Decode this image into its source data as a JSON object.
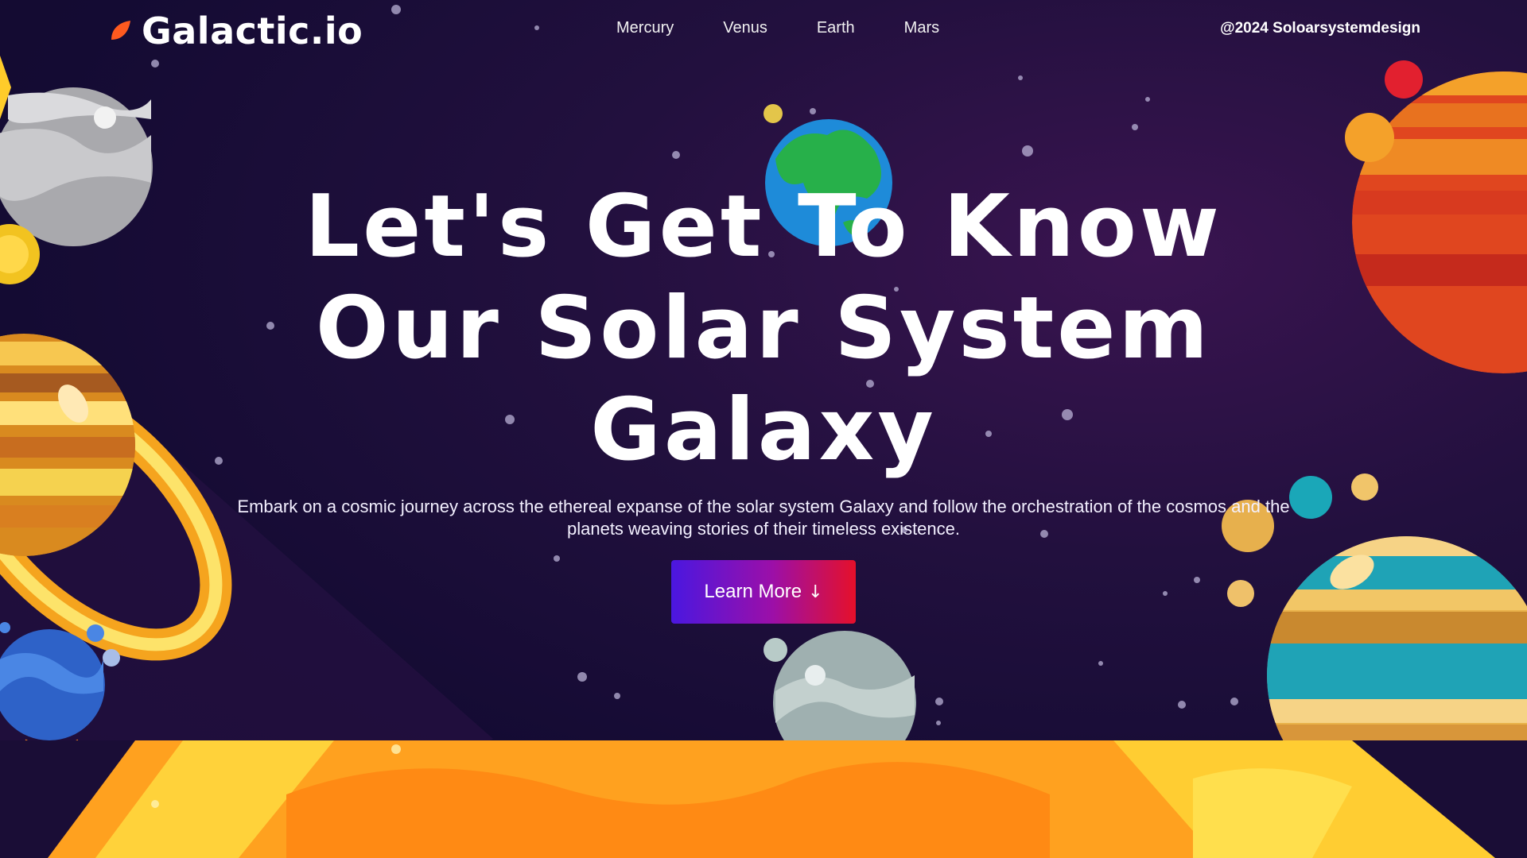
{
  "header": {
    "logo_text": "Galactic.io",
    "nav": [
      "Mercury",
      "Venus",
      "Earth",
      "Mars"
    ],
    "credit": "@2024 Soloarsystemdesign"
  },
  "hero": {
    "title_lines": [
      "Let's Get To Know",
      "Our Solar System",
      "Galaxy"
    ],
    "description": "Embark on a cosmic journey across the ethereal expanse of the solar system Galaxy and follow the orchestration of the cosmos and the planets weaving stories of their timeless existence.",
    "cta_label": "Learn More",
    "cta_icon": "arrow-down-icon"
  },
  "colors": {
    "background": "#140c35",
    "accent_start": "#4a17e0",
    "accent_end": "#e5102a",
    "sun": "#ffb020",
    "logo_leaf": "#ff5a1f"
  }
}
